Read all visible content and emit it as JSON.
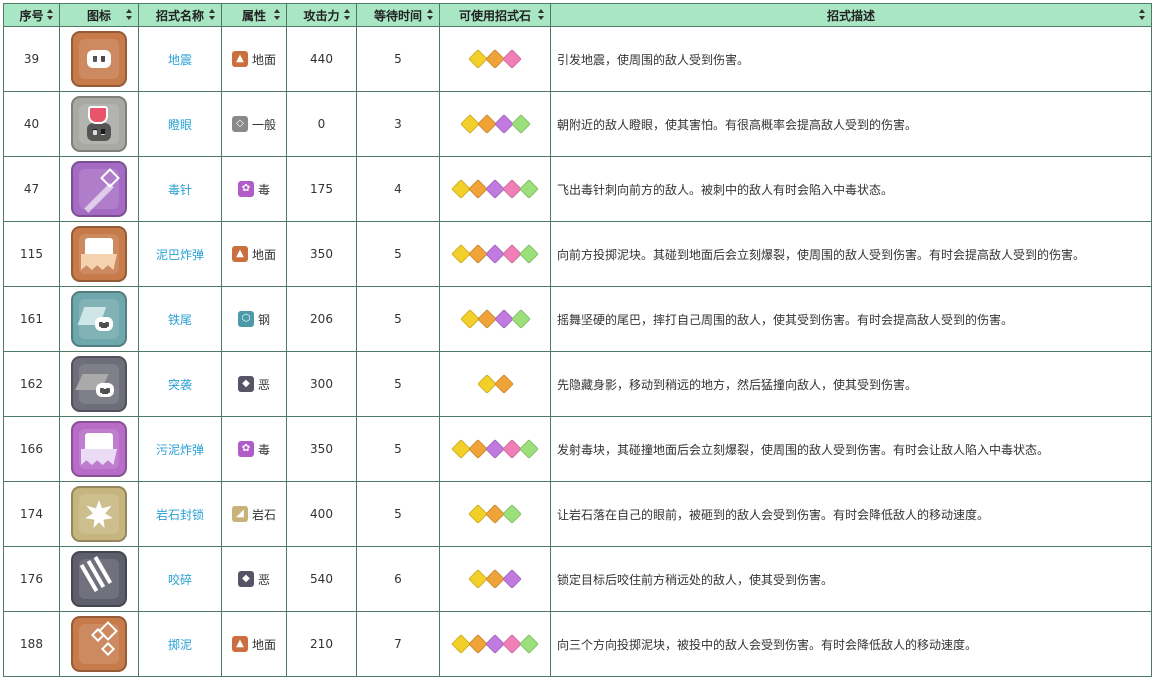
{
  "headers": {
    "num": "序号",
    "icon": "图标",
    "name": "招式名称",
    "attr": "属性",
    "atk": "攻击力",
    "wait": "等待时间",
    "stones": "可使用招式石",
    "desc": "招式描述"
  },
  "type_colors": {
    "地面": "#c9703e",
    "一般": "#8a8a8a",
    "毒": "#b25cc9",
    "钢": "#4a9aaa",
    "恶": "#555566",
    "岩石": "#c8b27a"
  },
  "stone_colors": [
    "#f3cf2a",
    "#f0a438",
    "#c07ae0",
    "#f07fb8",
    "#9be07a"
  ],
  "rows": [
    {
      "num": "39",
      "icon": "ground-face-icon",
      "icon_color": "#c77a4a",
      "name": "地震",
      "type": "地面",
      "atk": "440",
      "wait": "5",
      "stones": [
        0,
        1,
        3
      ],
      "desc": "引发地震，使周围的敌人受到伤害。"
    },
    {
      "num": "40",
      "icon": "normal-glare-icon",
      "icon_color": "#a9a9a4",
      "name": "瞪眼",
      "type": "一般",
      "atk": "0",
      "wait": "3",
      "stones": [
        0,
        1,
        2,
        4
      ],
      "desc": "朝附近的敌人瞪眼，使其害怕。有很高概率会提高敌人受到的伤害。"
    },
    {
      "num": "47",
      "icon": "poison-needle-icon",
      "icon_color": "#a56bc4",
      "name": "毒针",
      "type": "毒",
      "atk": "175",
      "wait": "4",
      "stones": [
        0,
        1,
        2,
        3,
        4
      ],
      "desc": "飞出毒针刺向前方的敌人。被刺中的敌人有时会陷入中毒状态。"
    },
    {
      "num": "115",
      "icon": "mud-bomb-icon",
      "icon_color": "#c77a4a",
      "name": "泥巴炸弹",
      "type": "地面",
      "atk": "350",
      "wait": "5",
      "stones": [
        0,
        1,
        2,
        3,
        4
      ],
      "desc": "向前方投掷泥块。其碰到地面后会立刻爆裂，使周围的敌人受到伤害。有时会提高敌人受到的伤害。"
    },
    {
      "num": "161",
      "icon": "iron-tail-icon",
      "icon_color": "#6fa8ac",
      "name": "铁尾",
      "type": "钢",
      "atk": "206",
      "wait": "5",
      "stones": [
        0,
        1,
        2,
        4
      ],
      "desc": "摇舞坚硬的尾巴，摔打自己周围的敌人，使其受到伤害。有时会提高敌人受到的伤害。"
    },
    {
      "num": "162",
      "icon": "dark-assault-icon",
      "icon_color": "#6e6e7a",
      "name": "突袭",
      "type": "恶",
      "atk": "300",
      "wait": "5",
      "stones": [
        0,
        1
      ],
      "desc": "先隐藏身影，移动到稍远的地方，然后猛撞向敌人，使其受到伤害。"
    },
    {
      "num": "166",
      "icon": "sludge-bomb-icon",
      "icon_color": "#b76cc8",
      "name": "污泥炸弹",
      "type": "毒",
      "atk": "350",
      "wait": "5",
      "stones": [
        0,
        1,
        2,
        3,
        4
      ],
      "desc": "发射毒块，其碰撞地面后会立刻爆裂，使周围的敌人受到伤害。有时会让敌人陷入中毒状态。"
    },
    {
      "num": "174",
      "icon": "rock-tomb-icon",
      "icon_color": "#c6b57e",
      "name": "岩石封锁",
      "type": "岩石",
      "atk": "400",
      "wait": "5",
      "stones": [
        0,
        1,
        4
      ],
      "desc": "让岩石落在自己的眼前，被砸到的敌人会受到伤害。有时会降低敌人的移动速度。"
    },
    {
      "num": "176",
      "icon": "crunch-icon",
      "icon_color": "#5e5e6c",
      "name": "咬碎",
      "type": "恶",
      "atk": "540",
      "wait": "6",
      "stones": [
        0,
        1,
        2
      ],
      "desc": "锁定目标后咬住前方稍远处的敌人，使其受到伤害。"
    },
    {
      "num": "188",
      "icon": "mud-shot-icon",
      "icon_color": "#c77a4a",
      "name": "掷泥",
      "type": "地面",
      "atk": "210",
      "wait": "7",
      "stones": [
        0,
        1,
        2,
        3,
        4
      ],
      "desc": "向三个方向投掷泥块，被投中的敌人会受到伤害。有时会降低敌人的移动速度。"
    }
  ]
}
